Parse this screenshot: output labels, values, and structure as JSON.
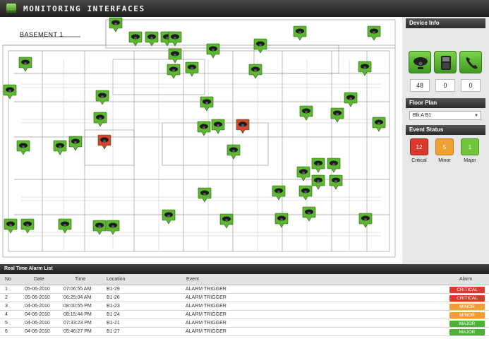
{
  "app": {
    "title": "MONITORING INTERFACES"
  },
  "map": {
    "floor_label": "BASEMENT 1"
  },
  "device_info": {
    "title": "Device Info",
    "buttons": [
      {
        "icon": "camera-icon",
        "count": "48"
      },
      {
        "icon": "intercom-icon",
        "count": "0"
      },
      {
        "icon": "phone-icon",
        "count": "0"
      }
    ]
  },
  "floor_plan": {
    "title": "Floor Plan",
    "selected": "Blk A B1"
  },
  "event_status": {
    "title": "Event Status",
    "critical": {
      "count": "12",
      "label": "Critical",
      "color": "#d83a2e"
    },
    "minor": {
      "count": "5",
      "label": "Minor",
      "color": "#f0a030"
    },
    "major": {
      "count": "1",
      "label": "Major",
      "color": "#72c43c"
    }
  },
  "alarm_list": {
    "title": "Real Time Alarm List",
    "columns": [
      "No",
      "Date",
      "Time",
      "Location",
      "Event",
      "Alarm"
    ],
    "rows": [
      {
        "no": "1",
        "date": "05-06-2010",
        "time": "07:06:55 AM",
        "location": "B1-29",
        "event": "ALARM TRIGGER",
        "alarm": "CRITICAL",
        "color": "#d83a2e"
      },
      {
        "no": "2",
        "date": "05-06-2010",
        "time": "06:25:04 AM",
        "location": "B1-26",
        "event": "ALARM TRIGGER",
        "alarm": "CRITICAL",
        "color": "#d83a2e"
      },
      {
        "no": "3",
        "date": "04-06-2010",
        "time": "08:00:55 PM",
        "location": "B1-23",
        "event": "ALARM TRIGGER",
        "alarm": "MINOR",
        "color": "#f0a030"
      },
      {
        "no": "4",
        "date": "04-06-2010",
        "time": "08:15:44 PM",
        "location": "B1-24",
        "event": "ALARM TRIGGER",
        "alarm": "MINOR",
        "color": "#f0a030"
      },
      {
        "no": "5",
        "date": "04-06-2010",
        "time": "07:33:23 PM",
        "location": "B1-21",
        "event": "ALARM TRIGGER",
        "alarm": "MAJOR",
        "color": "#4fb03a"
      },
      {
        "no": "6",
        "date": "04-06-2010",
        "time": "05:46:27 PM",
        "location": "B1-27",
        "event": "ALARM TRIGGER",
        "alarm": "MAJOR",
        "color": "#4fb03a"
      }
    ]
  },
  "status_colors": {
    "normal": "#5cb82e",
    "alarm": "#d9442f"
  }
}
